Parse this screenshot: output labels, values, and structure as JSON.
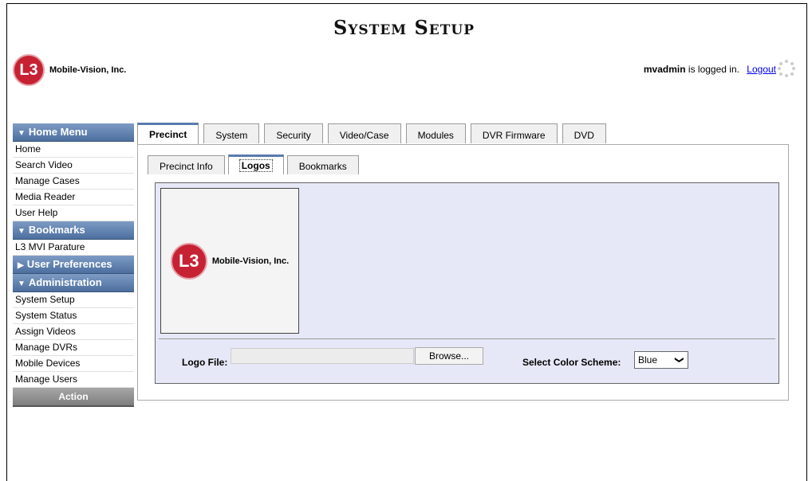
{
  "header": {
    "title": "System Setup",
    "company": "Mobile-Vision, Inc.",
    "logo_mark": "L3",
    "user": "mvadmin",
    "logged_in_text": "is logged in.",
    "logout": "Logout"
  },
  "sidebar": {
    "home_menu": "Home Menu",
    "home_items": [
      "Home",
      "Search Video",
      "Manage Cases",
      "Media Reader",
      "User Help"
    ],
    "bookmarks": "Bookmarks",
    "bookmark_items": [
      "L3 MVI Parature"
    ],
    "user_prefs": "User Preferences",
    "administration": "Administration",
    "admin_items": [
      "System Setup",
      "System Status",
      "Assign Videos",
      "Manage DVRs",
      "Mobile Devices",
      "Manage Users"
    ],
    "action": "Action"
  },
  "tabs": [
    "Precinct",
    "System",
    "Security",
    "Video/Case",
    "Modules",
    "DVR Firmware",
    "DVD"
  ],
  "subtabs": [
    "Precinct Info",
    "Logos",
    "Bookmarks"
  ],
  "logos": {
    "logo_file_label": "Logo File:",
    "file_value": "",
    "browse": "Browse...",
    "color_scheme_label": "Select Color Scheme:",
    "color_scheme": "Blue"
  }
}
